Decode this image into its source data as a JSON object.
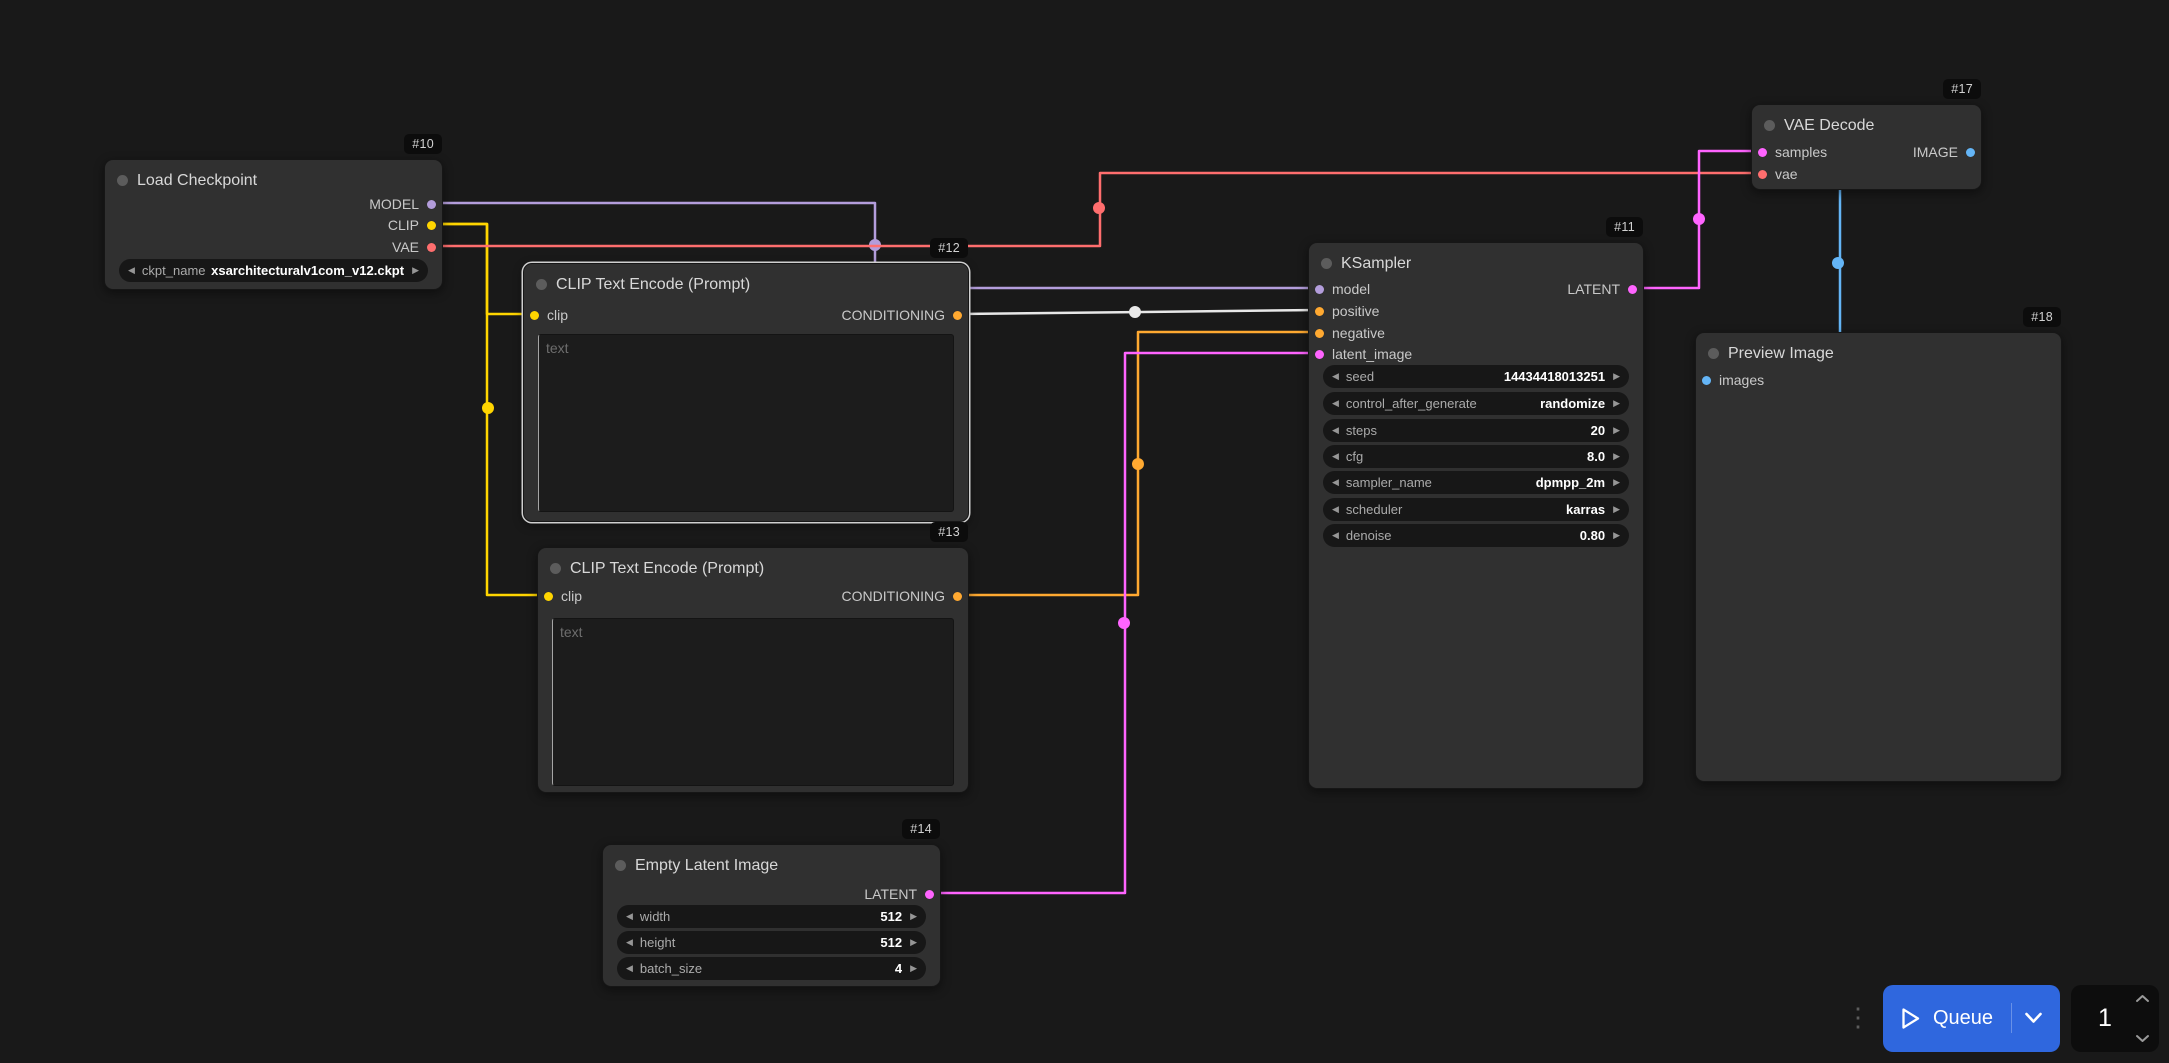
{
  "canvas": {
    "background": "#191919"
  },
  "colors": {
    "model": "#B39DDB",
    "clip": "#FFD500",
    "vae": "#FF6E6E",
    "conditioning": "#FFA931",
    "latent": "#FF64FF",
    "image": "#64B5F6",
    "link_highlight": "#E8E8E8",
    "accent_blue": "#2F67DE"
  },
  "icons": {
    "left_arrow": "◀",
    "right_arrow": "▶",
    "drag_handle": "⋮"
  },
  "nodes": [
    {
      "id": "#10",
      "title": "Load Checkpoint",
      "outputs": [
        "MODEL",
        "CLIP",
        "VAE"
      ],
      "widgets": [
        {
          "name": "ckpt_name",
          "value": "xsarchitecturalv1com_v12.ckpt"
        }
      ]
    },
    {
      "id": "#12",
      "title": "CLIP Text Encode (Prompt)",
      "inputs": [
        "clip"
      ],
      "outputs": [
        "CONDITIONING"
      ],
      "text_placeholder": "text"
    },
    {
      "id": "#13",
      "title": "CLIP Text Encode (Prompt)",
      "inputs": [
        "clip"
      ],
      "outputs": [
        "CONDITIONING"
      ],
      "text_placeholder": "text"
    },
    {
      "id": "#14",
      "title": "Empty Latent Image",
      "outputs": [
        "LATENT"
      ],
      "widgets": [
        {
          "name": "width",
          "value": "512"
        },
        {
          "name": "height",
          "value": "512"
        },
        {
          "name": "batch_size",
          "value": "4"
        }
      ]
    },
    {
      "id": "#11",
      "title": "KSampler",
      "inputs": [
        "model",
        "positive",
        "negative",
        "latent_image"
      ],
      "outputs": [
        "LATENT"
      ],
      "widgets": [
        {
          "name": "seed",
          "value": "14434418013251"
        },
        {
          "name": "control_after_generate",
          "value": "randomize"
        },
        {
          "name": "steps",
          "value": "20"
        },
        {
          "name": "cfg",
          "value": "8.0"
        },
        {
          "name": "sampler_name",
          "value": "dpmpp_2m"
        },
        {
          "name": "scheduler",
          "value": "karras"
        },
        {
          "name": "denoise",
          "value": "0.80"
        }
      ]
    },
    {
      "id": "#17",
      "title": "VAE Decode",
      "inputs": [
        "samples",
        "vae"
      ],
      "outputs": [
        "IMAGE"
      ]
    },
    {
      "id": "#18",
      "title": "Preview Image",
      "inputs": [
        "images"
      ]
    }
  ],
  "queue": {
    "run_label": "Queue",
    "batch_count": "1"
  }
}
